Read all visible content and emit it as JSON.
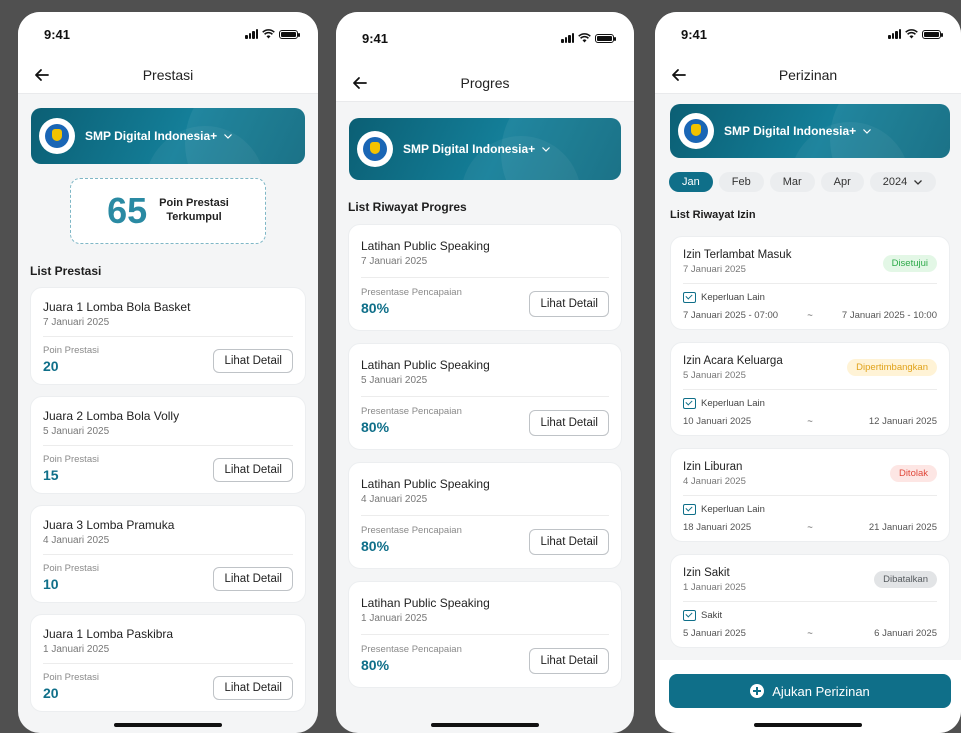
{
  "status": {
    "time": "9:41"
  },
  "prestasi": {
    "title": "Prestasi",
    "school": "SMP Digital Indonesia+",
    "points": "65",
    "points_label_1": "Poin Prestasi",
    "points_label_2": "Terkumpul",
    "list_title": "List Prestasi",
    "value_label": "Poin Prestasi",
    "button": "Lihat Detail",
    "items": [
      {
        "title": "Juara 1 Lomba Bola Basket",
        "date": "7 Januari 2025",
        "value": "20"
      },
      {
        "title": "Juara 2 Lomba Bola Volly",
        "date": "5 Januari 2025",
        "value": "15"
      },
      {
        "title": "Juara 3 Lomba Pramuka",
        "date": "4 Januari 2025",
        "value": "10"
      },
      {
        "title": "Juara 1 Lomba Paskibra",
        "date": "1 Januari 2025",
        "value": "20"
      }
    ]
  },
  "progres": {
    "title": "Progres",
    "school": "SMP Digital Indonesia+",
    "list_title": "List Riwayat Progres",
    "value_label": "Presentase Pencapaian",
    "button": "Lihat Detail",
    "items": [
      {
        "title": "Latihan Public Speaking",
        "date": "7 Januari 2025",
        "value": "80%"
      },
      {
        "title": "Latihan Public Speaking",
        "date": "5 Januari 2025",
        "value": "80%"
      },
      {
        "title": "Latihan Public Speaking",
        "date": "4 Januari 2025",
        "value": "80%"
      },
      {
        "title": "Latihan Public Speaking",
        "date": "1 Januari 2025",
        "value": "80%"
      }
    ]
  },
  "perizinan": {
    "title": "Perizinan",
    "school": "SMP Digital Indonesia+",
    "months": [
      "Jan",
      "Feb",
      "Mar",
      "Apr"
    ],
    "active_month": "Jan",
    "year": "2024",
    "list_title": "List Riwayat Izin",
    "separator": "~",
    "submit": "Ajukan Perizinan",
    "items": [
      {
        "title": "Izin Terlambat Masuk",
        "date": "7 Januari 2025",
        "status": "Disetujui",
        "status_bg": "#e3f7e6",
        "status_fg": "#2eaa4a",
        "reason": "Keperluan Lain",
        "start": "7 Januari 2025 - 07:00",
        "end": "7 Januari 2025 - 10:00"
      },
      {
        "title": "Izin Acara Keluarga",
        "date": "5 Januari 2025",
        "status": "Dipertimbangkan",
        "status_bg": "#fff3d6",
        "status_fg": "#e0a21a",
        "reason": "Keperluan Lain",
        "start": "10 Januari 2025",
        "end": "12 Januari 2025"
      },
      {
        "title": "Izin Liburan",
        "date": "4 Januari 2025",
        "status": "Ditolak",
        "status_bg": "#fde6e4",
        "status_fg": "#e0483a",
        "reason": "Keperluan Lain",
        "start": "18 Januari 2025",
        "end": "21 Januari 2025"
      },
      {
        "title": "Izin Sakit",
        "date": "1 Januari 2025",
        "status": "Dibatalkan",
        "status_bg": "#e2e4e6",
        "status_fg": "#555a5e",
        "reason": "Sakit",
        "start": "5 Januari 2025",
        "end": "6 Januari 2025"
      }
    ]
  }
}
